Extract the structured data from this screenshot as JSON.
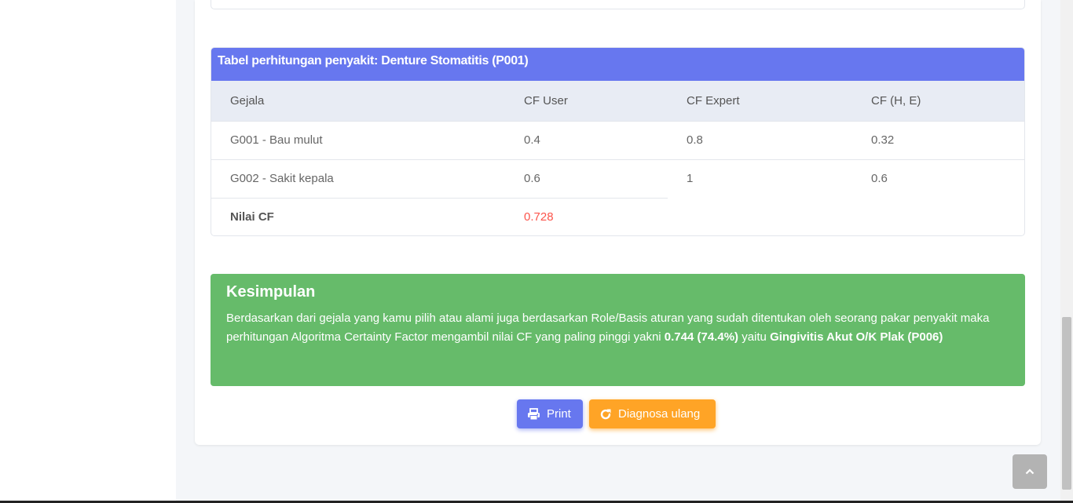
{
  "table": {
    "title": "Tabel perhitungan penyakit: Denture Stomatitis (P001)",
    "headers": [
      "Gejala",
      "CF User",
      "CF Expert",
      "CF (H, E)"
    ],
    "rows": [
      [
        "G001 - Bau mulut",
        "0.4",
        "0.8",
        "0.32"
      ],
      [
        "G002 - Sakit kepala",
        "0.6",
        "1",
        "0.6"
      ]
    ],
    "total_label": "Nilai CF",
    "total_value": "0.728"
  },
  "conclusion": {
    "title": "Kesimpulan",
    "text_prefix": "Berdasarkan dari gejala yang kamu pilih atau alami juga berdasarkan Role/Basis aturan yang sudah ditentukan oleh seorang pakar penyakit maka perhitungan Algoritma Certainty Factor mengambil nilai CF yang paling pinggi yakni ",
    "value": "0.744 (74.4%)",
    "middle": " yaitu ",
    "disease": "Gingivitis Akut O/K Plak (P006)"
  },
  "buttons": {
    "print_label": "Print",
    "reset_label": "Diagnosa ulang"
  },
  "icons": {
    "print": "printer-icon",
    "reset": "redo-icon",
    "scrolltop": "chevron-up-icon"
  },
  "colors": {
    "primary": "#6777ef",
    "success": "#66bb6a",
    "warning": "#ffa426",
    "danger": "#fc544b"
  }
}
